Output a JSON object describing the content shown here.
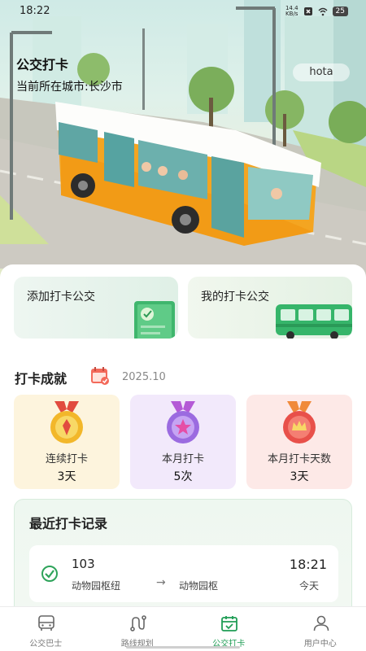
{
  "status": {
    "time": "18:22",
    "speed": "14.4",
    "speed_unit": "KB/s",
    "battery": "25"
  },
  "hero": {
    "title": "公交打卡",
    "city": "当前所在城市:长沙市",
    "user": "hota"
  },
  "actions": {
    "add_label": "添加打卡公交",
    "mine_label": "我的打卡公交"
  },
  "achievements": {
    "title": "打卡成就",
    "date": "2025.10",
    "items": [
      {
        "label": "连续打卡",
        "value": "3天",
        "color": "#f2b72a"
      },
      {
        "label": "本月打卡",
        "value": "5次",
        "color": "#9b6be0"
      },
      {
        "label": "本月打卡天数",
        "value": "3天",
        "color": "#e8504a"
      }
    ]
  },
  "records": {
    "title": "最近打卡记录",
    "items": [
      {
        "line": "103",
        "from": "动物园枢纽",
        "arrow": "→",
        "to": "动物园枢",
        "time": "18:21",
        "day": "今天"
      }
    ]
  },
  "nav": {
    "items": [
      {
        "label": "公交巴士",
        "icon": "bus-icon"
      },
      {
        "label": "路线规划",
        "icon": "route-icon"
      },
      {
        "label": "公交打卡",
        "icon": "calendar-check-icon",
        "active": true
      },
      {
        "label": "用户中心",
        "icon": "user-icon"
      }
    ]
  },
  "colors": {
    "accent": "#1f9d55",
    "bus_body": "#f4a521"
  }
}
